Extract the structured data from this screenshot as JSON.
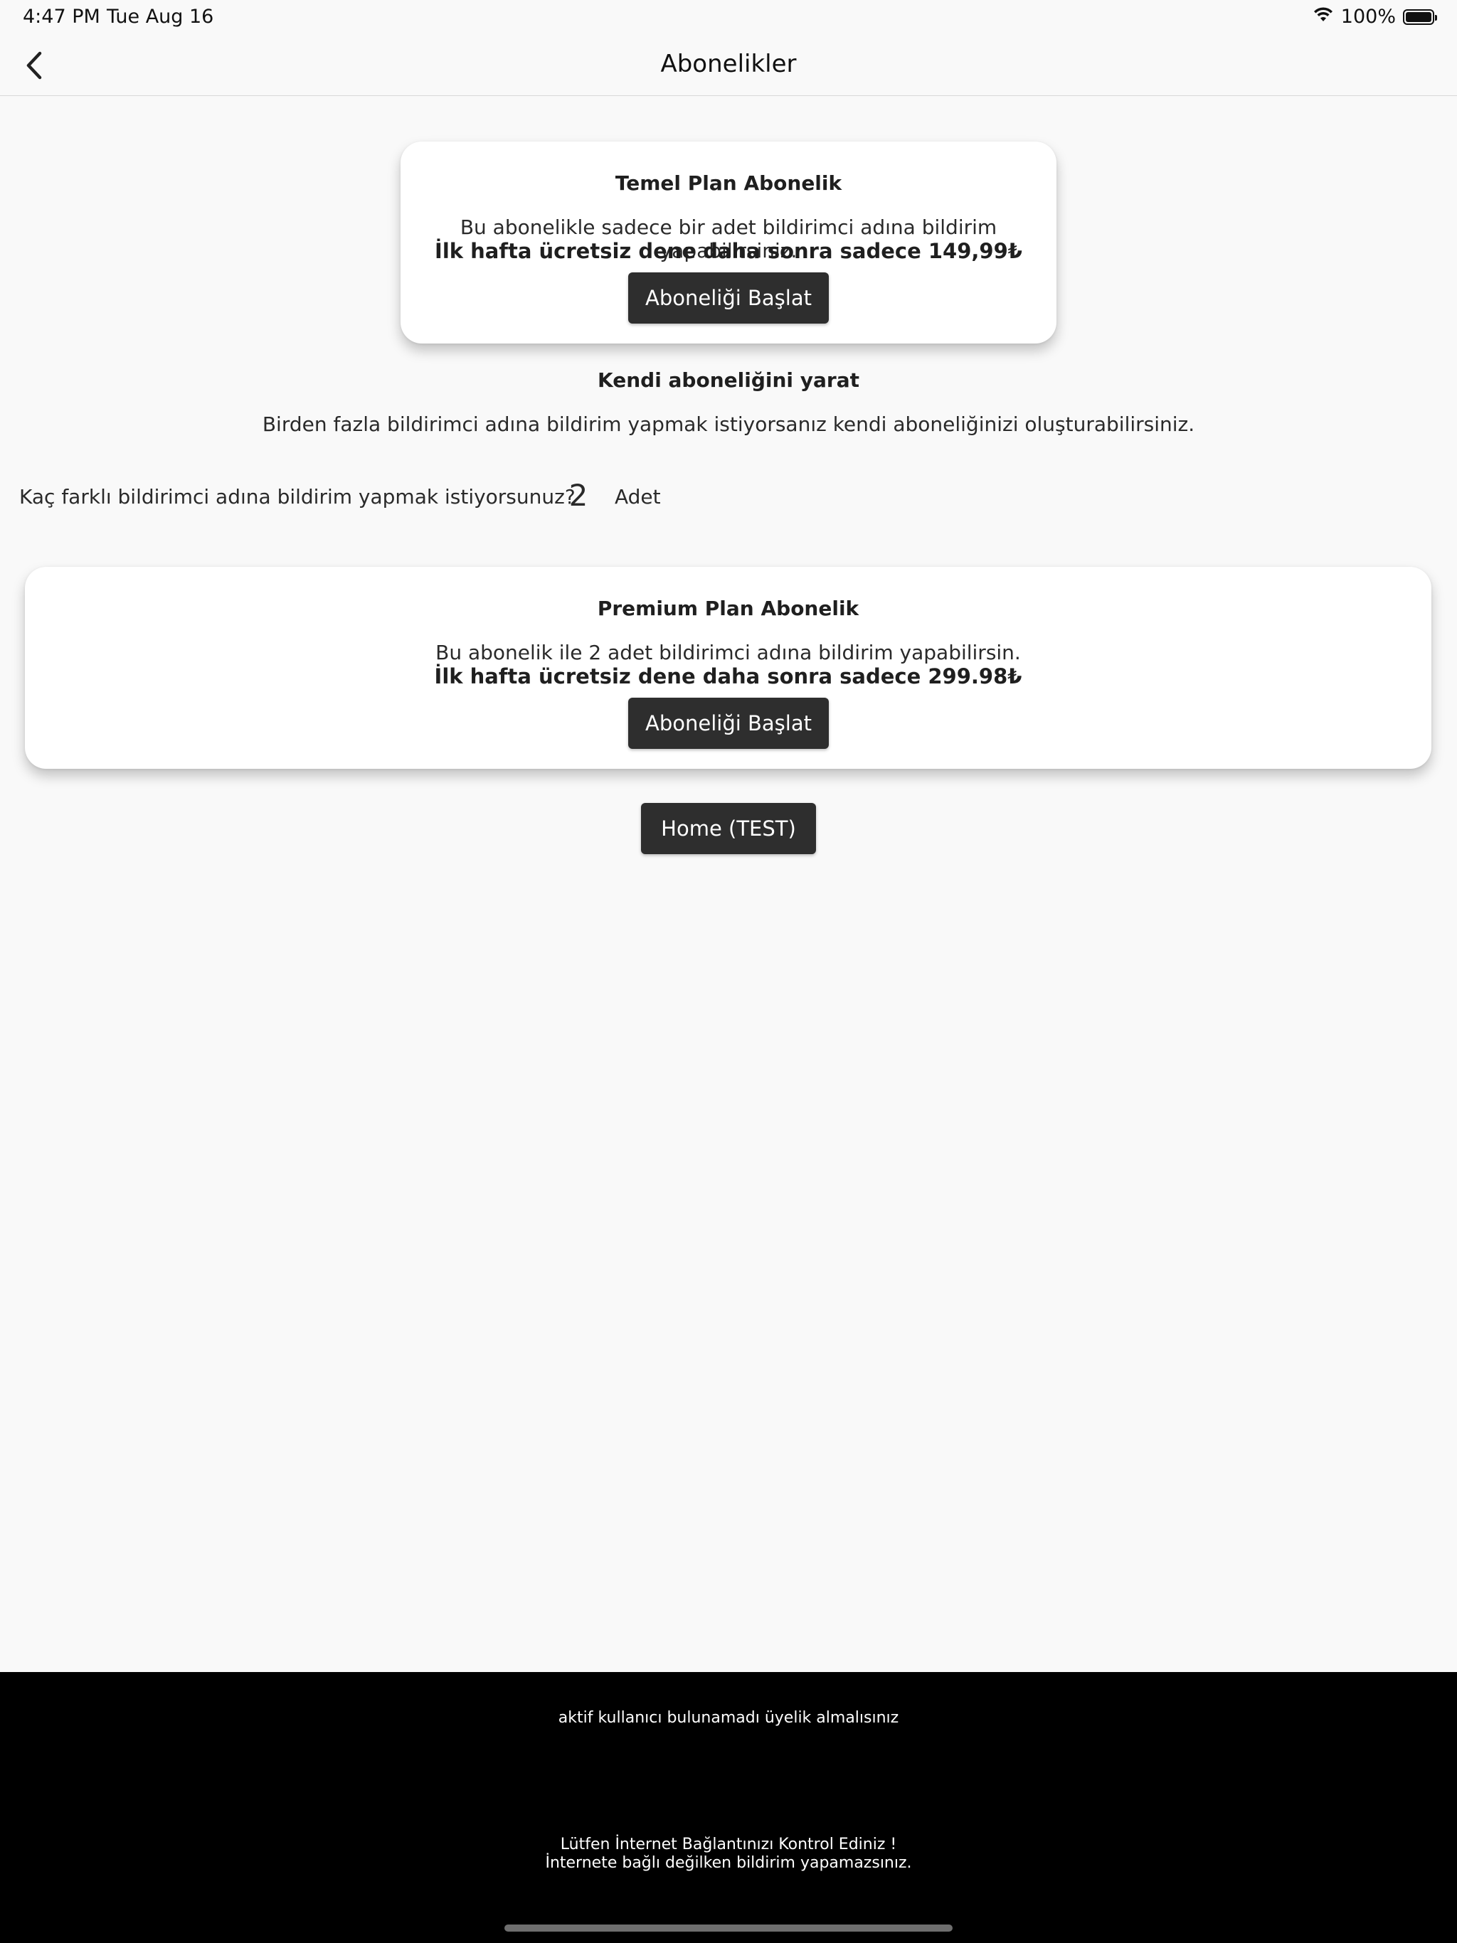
{
  "status_bar": {
    "time": "4:47 PM",
    "date": "Tue Aug 16",
    "battery_percent": "100%",
    "battery_level": 1.0
  },
  "nav": {
    "title": "Abonelikler",
    "back_icon": "chevron-left-icon"
  },
  "basic_plan": {
    "title": "Temel Plan Abonelik",
    "description": "Bu abonelikle sadece bir adet bildirimci adına bildirim yapabilirsiniz.",
    "price_text": "İlk hafta ücretsiz dene daha sonra sadece 149,99₺",
    "button_label": "Aboneliği Başlat"
  },
  "custom_section": {
    "title": "Kendi aboneliğini yarat",
    "description": "Birden fazla bildirimci adına bildirim yapmak istiyorsanız kendi aboneliğinizi oluşturabilirsiniz.",
    "question": "Kaç farklı bildirimci adına bildirim yapmak istiyorsunuz?",
    "count_value": "2",
    "unit": "Adet"
  },
  "premium_plan": {
    "title": "Premium Plan Abonelik",
    "description": "Bu abonelik ile 2 adet bildirimci adına bildirim yapabilirsin.",
    "price_text": "İlk hafta ücretsiz dene daha sonra sadece 299.98₺",
    "button_label": "Aboneliği Başlat"
  },
  "home_test_button": "Home (TEST)",
  "bottom_messages": {
    "no_user": "aktif kullanıcı bulunamadı üyelik almalısınız",
    "connection_line1": "Lütfen İnternet Bağlantınızı Kontrol Ediniz !",
    "connection_line2": "İnternete bağlı değilken bildirim yapamazsınız."
  },
  "colors": {
    "background": "#f9f9f9",
    "button": "#2e2e2e",
    "bottom_bar": "#000000"
  }
}
